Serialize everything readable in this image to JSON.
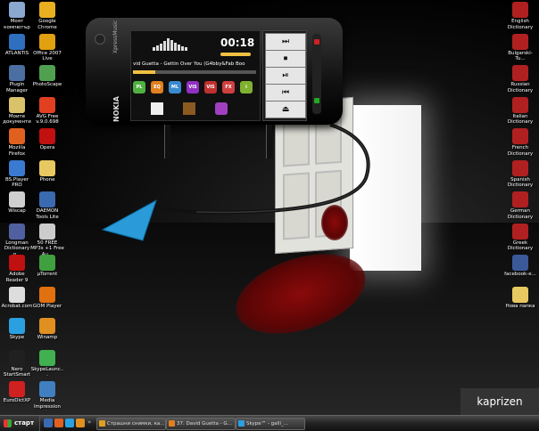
{
  "desktop": {
    "left_col1": [
      {
        "label": "Моят компютър",
        "color": "#8aa8d0"
      },
      {
        "label": "ATLANTIS",
        "color": "#2f6fc0"
      },
      {
        "label": "Plugin Manager",
        "color": "#4a6fa0"
      },
      {
        "label": "Моите документи",
        "color": "#d9c26a"
      },
      {
        "label": "Mozilla Firefox",
        "color": "#e06020"
      },
      {
        "label": "BS.Player PRO",
        "color": "#3a7ad0"
      },
      {
        "label": "Wiscap",
        "color": "#cfcfcf"
      },
      {
        "label": "Longman Dictionary o...",
        "color": "#5060a0"
      },
      {
        "label": "Adobe Reader 9",
        "color": "#c01010"
      },
      {
        "label": "Acrobat.com",
        "color": "#dddddd"
      },
      {
        "label": "Skype",
        "color": "#2aa0e0"
      },
      {
        "label": "Nero StartSmart",
        "color": "#202020"
      },
      {
        "label": "EuroDictXP",
        "color": "#d02020"
      }
    ],
    "left_col2": [
      {
        "label": "Google Chrome",
        "color": "#e8b020"
      },
      {
        "label": "Office 2007 Live",
        "color": "#e0a010"
      },
      {
        "label": "PhotoScape",
        "color": "#50a050"
      },
      {
        "label": "AVG Free v.9.0.698",
        "color": "#e04020"
      },
      {
        "label": "Opera",
        "color": "#c01010"
      },
      {
        "label": "Phone",
        "color": "#e8c860"
      },
      {
        "label": "DAEMON Tools Lite",
        "color": "#3a6ab0"
      },
      {
        "label": "50 FREE MP3s +1 Free Au...",
        "color": "#cccccc"
      },
      {
        "label": "µTorrent",
        "color": "#40a040"
      },
      {
        "label": "GOM Player",
        "color": "#e07010"
      },
      {
        "label": "Winamp",
        "color": "#e09020"
      },
      {
        "label": "SkypeLaunc...",
        "color": "#40b050"
      },
      {
        "label": "Media Impression",
        "color": "#4080c0"
      }
    ],
    "right_col": [
      {
        "label": "English Dictionary",
        "color": "#b02020"
      },
      {
        "label": "Bulgarski-Tu...",
        "color": "#b02020"
      },
      {
        "label": "Russian Dictionary",
        "color": "#b02020"
      },
      {
        "label": "Italian Dictionary",
        "color": "#b02020"
      },
      {
        "label": "French Dictionary",
        "color": "#b02020"
      },
      {
        "label": "Spanish Dictionary",
        "color": "#b02020"
      },
      {
        "label": "German Dictionary",
        "color": "#b02020"
      },
      {
        "label": "Greek Dictionary",
        "color": "#b02020"
      },
      {
        "label": "facebook-e...",
        "color": "#3b5998"
      },
      {
        "label": "Нова папка",
        "color": "#e8c860"
      }
    ]
  },
  "phone": {
    "brand": "NOKIA",
    "side_label": "XpressMusic",
    "time": "00:18",
    "track": "vid Guetta - Gettin Over You (G4bby&Fab Boo",
    "controls": [
      "⏭",
      "⏹",
      "⏯",
      "⏮",
      "⏏"
    ],
    "apps": [
      {
        "label": "PL",
        "color": "#50b040"
      },
      {
        "label": "EQ",
        "color": "#e08020"
      },
      {
        "label": "ML",
        "color": "#3a8ad0"
      },
      {
        "label": "VIS",
        "color": "#9030c0"
      },
      {
        "label": "VIS",
        "color": "#c03030"
      },
      {
        "label": "FX",
        "color": "#d04040"
      },
      {
        "label": "i",
        "color": "#80b030"
      }
    ]
  },
  "taskbar": {
    "start_label": "старт",
    "tasks": [
      {
        "label": "Страшни снимки, ка...",
        "color": "#e0a020"
      },
      {
        "label": "37. David Guetta - G...",
        "color": "#e08020"
      },
      {
        "label": "Skype™ - galli_...",
        "color": "#2aa0e0"
      }
    ],
    "watermark": "kaprizen"
  }
}
